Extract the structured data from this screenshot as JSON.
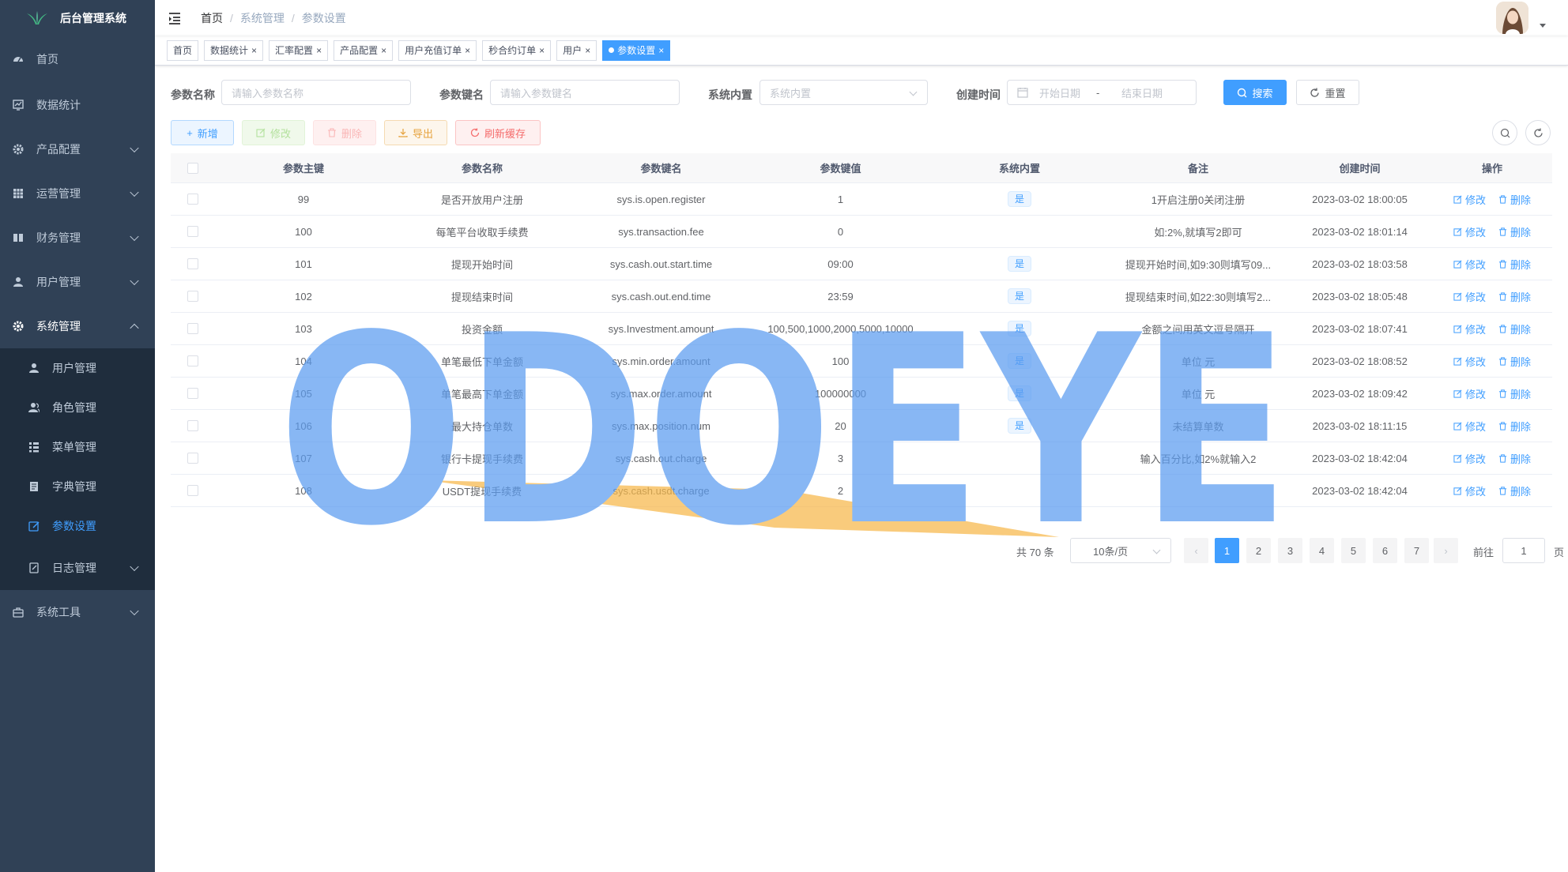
{
  "app": {
    "title": "后台管理系统"
  },
  "sidebar": {
    "items": [
      {
        "label": "首页",
        "icon": "dashboard-icon"
      },
      {
        "label": "数据统计",
        "icon": "chart-icon"
      },
      {
        "label": "产品配置",
        "icon": "gear-icon",
        "expandable": true
      },
      {
        "label": "运营管理",
        "icon": "grid-icon",
        "expandable": true
      },
      {
        "label": "财务管理",
        "icon": "book-icon",
        "expandable": true
      },
      {
        "label": "用户管理",
        "icon": "user-icon",
        "expandable": true
      },
      {
        "label": "系统管理",
        "icon": "system-icon",
        "expandable": true,
        "open": true
      }
    ],
    "sub": [
      {
        "label": "用户管理",
        "icon": "user-icon"
      },
      {
        "label": "角色管理",
        "icon": "peoples-icon"
      },
      {
        "label": "菜单管理",
        "icon": "tree-table-icon"
      },
      {
        "label": "字典管理",
        "icon": "dict-icon"
      },
      {
        "label": "参数设置",
        "icon": "edit-icon",
        "active": true
      },
      {
        "label": "日志管理",
        "icon": "log-icon",
        "expandable": true
      }
    ],
    "after": [
      {
        "label": "系统工具",
        "icon": "tool-icon",
        "expandable": true
      }
    ]
  },
  "breadcrumb": [
    "首页",
    "系统管理",
    "参数设置"
  ],
  "tags": [
    {
      "label": "首页",
      "closable": false
    },
    {
      "label": "数据统计",
      "closable": true
    },
    {
      "label": "汇率配置",
      "closable": true
    },
    {
      "label": "产品配置",
      "closable": true
    },
    {
      "label": "用户充值订单",
      "closable": true
    },
    {
      "label": "秒合约订单",
      "closable": true
    },
    {
      "label": "用户",
      "closable": true
    },
    {
      "label": "参数设置",
      "closable": true,
      "active": true
    }
  ],
  "search": {
    "name_label": "参数名称",
    "name_placeholder": "请输入参数名称",
    "key_label": "参数键名",
    "key_placeholder": "请输入参数键名",
    "builtin_label": "系统内置",
    "builtin_placeholder": "系统内置",
    "time_label": "创建时间",
    "start_placeholder": "开始日期",
    "range_sep": "-",
    "end_placeholder": "结束日期",
    "search_btn": "搜索",
    "reset_btn": "重置"
  },
  "toolbar": {
    "add": "新增",
    "edit": "修改",
    "delete": "删除",
    "export": "导出",
    "refresh_cache": "刷新缓存"
  },
  "table": {
    "columns": [
      "参数主键",
      "参数名称",
      "参数键名",
      "参数键值",
      "系统内置",
      "备注",
      "创建时间",
      "操作"
    ],
    "edit_label": "修改",
    "delete_label": "删除",
    "rows": [
      {
        "id": "99",
        "name": "是否开放用户注册",
        "key": "sys.is.open.register",
        "value": "1",
        "builtin": "是",
        "remark": "1开启注册0关闭注册",
        "created": "2023-03-02 18:00:05"
      },
      {
        "id": "100",
        "name": "每笔平台收取手续费",
        "key": "sys.transaction.fee",
        "value": "0",
        "builtin": "",
        "remark": "如:2%,就填写2即可",
        "created": "2023-03-02 18:01:14"
      },
      {
        "id": "101",
        "name": "提现开始时间",
        "key": "sys.cash.out.start.time",
        "value": "09:00",
        "builtin": "是",
        "remark": "提现开始时间,如9:30则填写09...",
        "created": "2023-03-02 18:03:58"
      },
      {
        "id": "102",
        "name": "提现结束时间",
        "key": "sys.cash.out.end.time",
        "value": "23:59",
        "builtin": "是",
        "remark": "提现结束时间,如22:30则填写2...",
        "created": "2023-03-02 18:05:48"
      },
      {
        "id": "103",
        "name": "投资金额",
        "key": "sys.Investment.amount",
        "value": "100,500,1000,2000,5000,10000",
        "builtin": "是",
        "remark": "金额之间用英文逗号隔开",
        "created": "2023-03-02 18:07:41"
      },
      {
        "id": "104",
        "name": "单笔最低下单金额",
        "key": "sys.min.order.amount",
        "value": "100",
        "builtin": "是",
        "remark": "单位 元",
        "created": "2023-03-02 18:08:52"
      },
      {
        "id": "105",
        "name": "单笔最高下单金额",
        "key": "sys.max.order.amount",
        "value": "100000000",
        "builtin": "是",
        "remark": "单位 元",
        "created": "2023-03-02 18:09:42"
      },
      {
        "id": "106",
        "name": "最大持仓单数",
        "key": "sys.max.position.num",
        "value": "20",
        "builtin": "是",
        "remark": "未结算单数",
        "created": "2023-03-02 18:11:15"
      },
      {
        "id": "107",
        "name": "银行卡提现手续费",
        "key": "sys.cash.out.charge",
        "value": "3",
        "builtin": "",
        "remark": "输入百分比,如2%就输入2",
        "created": "2023-03-02 18:42:04"
      },
      {
        "id": "108",
        "name": "USDT提现手续费",
        "key": "sys.cash.usdt.charge",
        "value": "2",
        "builtin": "",
        "remark": "",
        "created": "2023-03-02 18:42:04"
      }
    ]
  },
  "pagination": {
    "total": "共 70 条",
    "page_size": "10条/页",
    "pages": [
      "1",
      "2",
      "3",
      "4",
      "5",
      "6",
      "7"
    ],
    "current": "1",
    "goto_label": "前往",
    "goto_value": "1",
    "page_unit": "页"
  },
  "watermark": {
    "text": "ODOEYE",
    "color": "#5b9cf0",
    "accent": "#f7b84a"
  },
  "colors": {
    "sidebar_bg": "#304156",
    "submenu_bg": "#1f2d3d",
    "primary": "#409eff"
  }
}
